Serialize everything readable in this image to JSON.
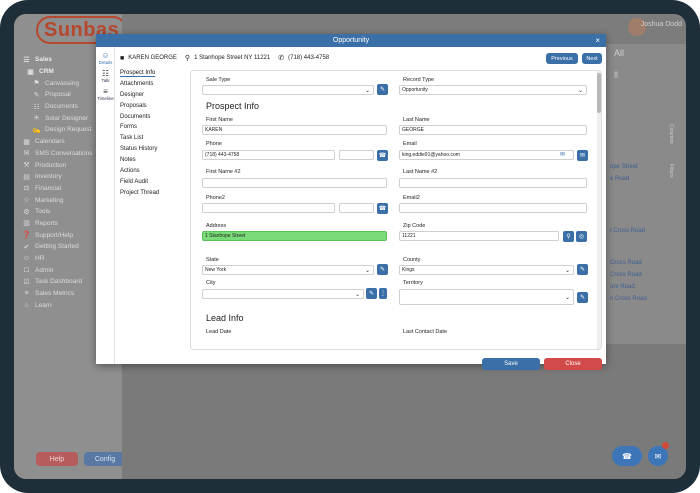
{
  "app": {
    "logo": "Sunbas",
    "username": "Joshua Dodd"
  },
  "sidebar": {
    "items": [
      {
        "icon": "sales-icon",
        "glyph": "☰",
        "label": "Sales",
        "level": 0,
        "bold": true
      },
      {
        "icon": "crm-icon",
        "glyph": "▣",
        "label": "CRM",
        "level": 1,
        "bold": true
      },
      {
        "icon": "canvassing-icon",
        "glyph": "⚑",
        "label": "Canvassing",
        "level": 2
      },
      {
        "icon": "proposal-icon",
        "glyph": "✎",
        "label": "Proposal",
        "level": 2
      },
      {
        "icon": "documents-icon",
        "glyph": "☷",
        "label": "Documents",
        "level": 2
      },
      {
        "icon": "solar-designer-icon",
        "glyph": "☀",
        "label": "Solar Designer",
        "level": 2
      },
      {
        "icon": "design-request-icon",
        "glyph": "✍",
        "label": "Design Request",
        "level": 2
      },
      {
        "icon": "calendars-icon",
        "glyph": "▦",
        "label": "Calendars",
        "level": 0
      },
      {
        "icon": "sms-icon",
        "glyph": "✉",
        "label": "SMS Conversations",
        "level": 0
      },
      {
        "icon": "production-icon",
        "glyph": "⚒",
        "label": "Production",
        "level": 0
      },
      {
        "icon": "inventory-icon",
        "glyph": "▤",
        "label": "Inventory",
        "level": 0
      },
      {
        "icon": "financial-icon",
        "glyph": "⚖",
        "label": "Financial",
        "level": 0
      },
      {
        "icon": "marketing-icon",
        "glyph": "☆",
        "label": "Marketing",
        "level": 0
      },
      {
        "icon": "tools-icon",
        "glyph": "⚙",
        "label": "Tools",
        "level": 0
      },
      {
        "icon": "reports-icon",
        "glyph": "▥",
        "label": "Reports",
        "level": 0
      },
      {
        "icon": "support-icon",
        "glyph": "❓",
        "label": "Support/Help",
        "level": 0
      },
      {
        "icon": "getting-started-icon",
        "glyph": "✔",
        "label": "Getting Started",
        "level": 0
      },
      {
        "icon": "hr-icon",
        "glyph": "☺",
        "label": "HR",
        "level": 0
      },
      {
        "icon": "admin-icon",
        "glyph": "☖",
        "label": "Admin",
        "level": 0
      },
      {
        "icon": "task-dashboard-icon",
        "glyph": "☑",
        "label": "Task Dashboard",
        "level": 0
      },
      {
        "icon": "sales-metrics-icon",
        "glyph": "≡",
        "label": "Sales Metrics",
        "level": 0
      },
      {
        "icon": "learn-icon",
        "glyph": "⌂",
        "label": "Learn",
        "level": 0
      }
    ],
    "help": "Help",
    "config": "Config"
  },
  "background": {
    "right_items": [
      "ope Street",
      "e Road",
      "t Cross Road",
      "Cross Road",
      "Cross Road",
      "ore Road",
      "n Cross Road"
    ],
    "right_tab_columns": "Columns",
    "right_tab_filters": "Filters",
    "all_label": "All",
    "all_label2": "ll"
  },
  "modal": {
    "title": "Opportunity",
    "close_glyph": "×",
    "customer": "KAREN GEORGE",
    "address": "1 Stanhope Street NY 11221",
    "phone": "(718) 443-4758",
    "prev_label": "Previous",
    "next_label": "Next",
    "rail": [
      {
        "icon": "details-icon",
        "glyph": "☺",
        "label": "Details",
        "active": true
      },
      {
        "icon": "talk-icon",
        "glyph": "☷",
        "label": "Talk",
        "active": false
      },
      {
        "icon": "timeline-icon",
        "glyph": "≡",
        "label": "Timeline",
        "active": false
      }
    ],
    "subnav": [
      "Prospect Info",
      "Attachments",
      "Designer",
      "Proposals",
      "Documents",
      "Forms",
      "Task List",
      "Status History",
      "Notes",
      "Actions",
      "Field Audit",
      "Project Thread"
    ],
    "save_label": "Save",
    "close_label": "Close"
  },
  "form": {
    "sale_type_label": "Sale Type",
    "sale_type_value": "",
    "record_type_label": "Record Type",
    "record_type_value": "Opportunity",
    "section_prospect": "Prospect Info",
    "first_name_label": "First Name",
    "first_name_value": "KAREN",
    "last_name_label": "Last Name",
    "last_name_value": "GEORGE",
    "phone_label": "Phone",
    "phone_value": "(718) 443-4758",
    "email_label": "Email",
    "email_value": "king.eddie91@yahoo.com",
    "first_name2_label": "First Name #2",
    "last_name2_label": "Last Name #2",
    "phone2_label": "Phone2",
    "email2_label": "Email2",
    "address_label": "Address",
    "address_value": "1 Stanhope Street",
    "zip_label": "Zip Code",
    "zip_value": "11221",
    "state_label": "State",
    "state_value": "New York",
    "county_label": "County",
    "county_value": "Kings",
    "city_label": "City",
    "territory_label": "Territory",
    "section_lead": "Lead Info",
    "lead_date_label": "Lead Date",
    "last_contact_label": "Last Contact Date"
  }
}
